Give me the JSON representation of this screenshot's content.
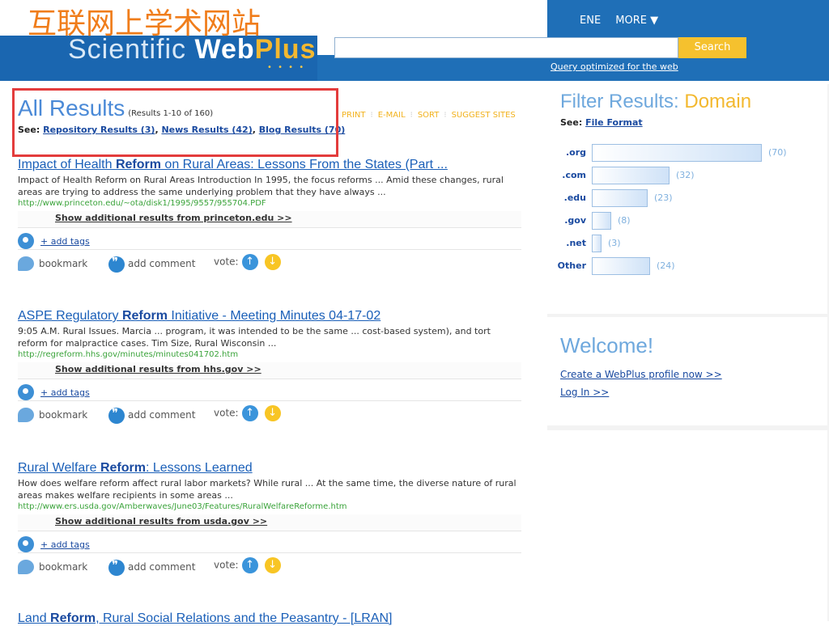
{
  "header": {
    "overlay_text": "互联网上学术网站",
    "logo_text": "Scientific",
    "logo_web": "Web",
    "logo_plus": "Plus",
    "nav_items": [
      "ENE",
      "MORE ▼"
    ],
    "search_button": "Search",
    "search_placeholder": "",
    "query_note": "Query optimized for the web"
  },
  "results_header": {
    "title": "All Results",
    "count": "(Results 1-10 of 160)",
    "see_label": "See:",
    "see_links": [
      "Repository Results (3)",
      "News Results (42)",
      "Blog Results (70)"
    ],
    "toolbar": [
      "PRINT",
      "E-MAIL",
      "SORT",
      "SUGGEST SITES"
    ]
  },
  "results": [
    {
      "title_pre": "Impact of Health ",
      "title_bold": "Reform",
      "title_post": " on Rural Areas: Lessons From the States (Part ...",
      "snippet": "Impact of Health Reform on Rural Areas Introduction In 1995, the focus reforms ... Amid these changes, rural areas are trying to address the same underlying problem that they have always ...",
      "url": "http://www.princeton.edu/~ota/disk1/1995/9557/955704.PDF",
      "more": "Show additional results from princeton.edu >>"
    },
    {
      "title_pre": "ASPE Regulatory ",
      "title_bold": "Reform",
      "title_post": " Initiative - Meeting Minutes 04-17-02",
      "snippet": "9:05 A.M. Rural Issues. Marcia ... program, it was intended to be the same ... cost-based system), and tort reform for malpractice cases. Tim Size, Rural Wisconsin ...",
      "url": "http://regreform.hhs.gov/minutes/minutes041702.htm",
      "more": "Show additional results from hhs.gov >>"
    },
    {
      "title_pre": "Rural Welfare ",
      "title_bold": "Reform",
      "title_post": ": Lessons Learned",
      "snippet": "How does welfare reform affect rural labor markets? While rural ... At the same time, the diverse nature of rural areas makes welfare recipients in some areas ...",
      "url": "http://www.ers.usda.gov/Amberwaves/June03/Features/RuralWelfareReforme.htm",
      "more": "Show additional results from usda.gov >>"
    },
    {
      "title_pre": "Land ",
      "title_bold": "Reform",
      "title_post": ", Rural Social Relations and the Peasantry - [LRAN]"
    }
  ],
  "result_actions": {
    "add_tags": "+ add tags",
    "bookmark": "bookmark",
    "add_comment": "add comment",
    "vote": "vote:"
  },
  "filter": {
    "title": "Filter Results:",
    "title_highlight": "Domain",
    "see_label": "See:",
    "see_link": "File Format",
    "domains": [
      {
        "label": ".org",
        "count": "(70)",
        "value": 70
      },
      {
        "label": ".com",
        "count": "(32)",
        "value": 32
      },
      {
        "label": ".edu",
        "count": "(23)",
        "value": 23
      },
      {
        "label": ".gov",
        "count": "(8)",
        "value": 8
      },
      {
        "label": ".net",
        "count": "(3)",
        "value": 3
      },
      {
        "label": "Other",
        "count": "(24)",
        "value": 24
      }
    ]
  },
  "welcome": {
    "title": "Welcome!",
    "create_profile": "Create a WebPlus profile now >>",
    "login": "Log In >>"
  }
}
